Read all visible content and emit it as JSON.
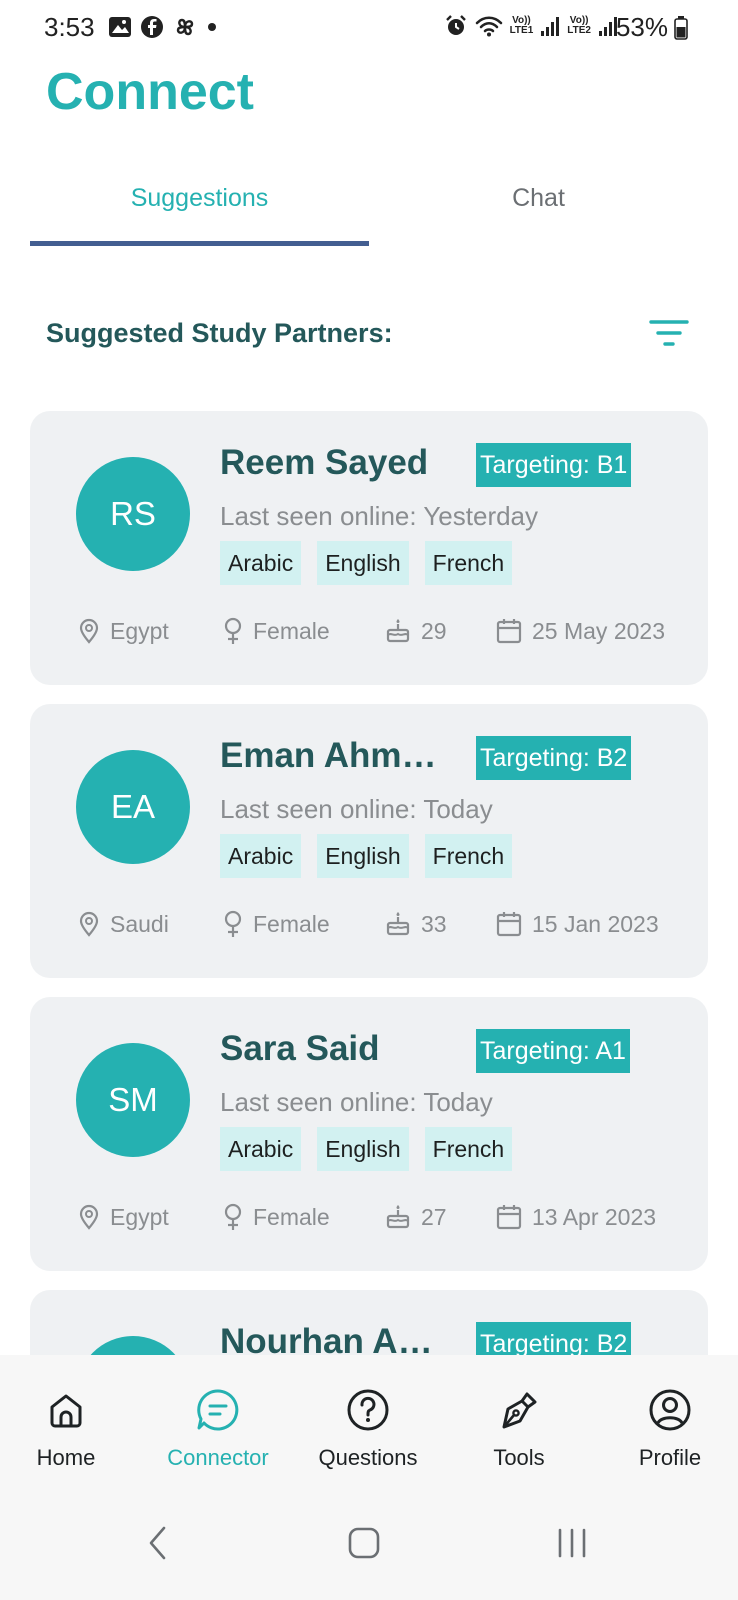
{
  "status_bar": {
    "time": "3:53",
    "battery": "53%",
    "lte1": "LTE1",
    "lte2": "LTE2",
    "volte": "Vo))"
  },
  "app_title": "Connect",
  "tabs": [
    {
      "label": "Suggestions",
      "active": true
    },
    {
      "label": "Chat",
      "active": false
    }
  ],
  "section_title": "Suggested Study Partners:",
  "partners": [
    {
      "initials": "RS",
      "name": "Reem Sayed",
      "targeting": "Targeting: B1",
      "last_seen": "Last seen online: Yesterday",
      "languages": [
        "Arabic",
        "English",
        "French"
      ],
      "country": "Egypt",
      "gender": "Female",
      "age": "29",
      "date": "25 May 2023"
    },
    {
      "initials": "EA",
      "name": "Eman Ahm…",
      "targeting": "Targeting: B2",
      "last_seen": "Last seen online: Today",
      "languages": [
        "Arabic",
        "English",
        "French"
      ],
      "country": "Saudi",
      "gender": "Female",
      "age": "33",
      "date": "15 Jan 2023"
    },
    {
      "initials": "SM",
      "name": "Sara Said",
      "targeting": "Targeting: A1",
      "last_seen": "Last seen online: Today",
      "languages": [
        "Arabic",
        "English",
        "French"
      ],
      "country": "Egypt",
      "gender": "Female",
      "age": "27",
      "date": "13 Apr 2023"
    },
    {
      "initials": "",
      "name": "Nourhan A…",
      "targeting": "Targeting: B2"
    }
  ],
  "bottom_nav": [
    {
      "label": "Home",
      "icon": "home-icon",
      "active": false
    },
    {
      "label": "Connector",
      "icon": "chat-bubble-icon",
      "active": true
    },
    {
      "label": "Questions",
      "icon": "question-icon",
      "active": false
    },
    {
      "label": "Tools",
      "icon": "pen-icon",
      "active": false
    },
    {
      "label": "Profile",
      "icon": "profile-icon",
      "active": false
    }
  ],
  "colors": {
    "accent": "#25b1b1",
    "title_text": "#24585a",
    "tab_indicator": "#435e91",
    "card_bg": "#eff1f3",
    "language_chip_bg": "#d2f1f1"
  }
}
